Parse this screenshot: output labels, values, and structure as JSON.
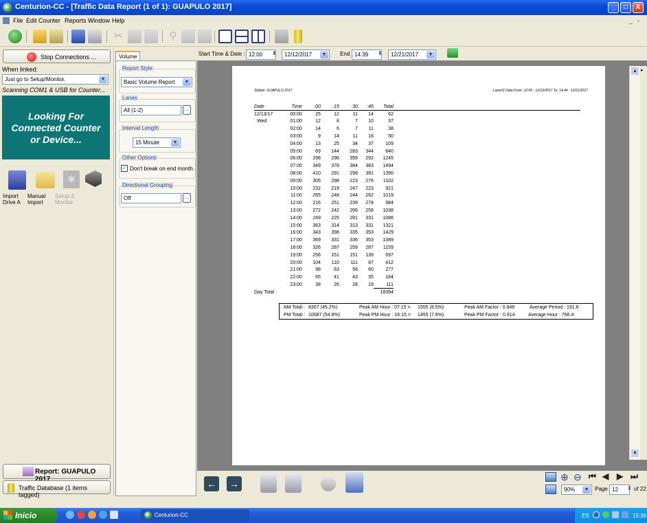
{
  "window": {
    "title": "Centurion-CC - [Traffic Data Report (1 of 1): GUAPULO 2017]",
    "controls": [
      "_",
      "□",
      "X"
    ]
  },
  "menu": {
    "items": [
      "File",
      "Edit",
      "Counter",
      "Reports",
      "Window",
      "Help"
    ]
  },
  "left": {
    "stop_button": "Stop Connections ...",
    "when_linked_label": "When linked:",
    "when_linked_value": "Just go to Setup/Monitor.",
    "scanning_text": "Scanning COM1 & USB for Counter...",
    "banner": [
      "Looking For",
      "Connected Counter",
      "or Device..."
    ],
    "icons": [
      {
        "label1": "Import",
        "label2": "Drive A"
      },
      {
        "label1": "Manual",
        "label2": "Import"
      },
      {
        "label1": "Setup &",
        "label2": "Monitor"
      }
    ],
    "report_button": "Report: GUAPULO 2017",
    "database_button": "Traffic Database (1 items tagged)"
  },
  "options": {
    "tab": "Volume",
    "report_style_label": "Report Style",
    "report_style_value": "Basic Volume Report",
    "lanes_label": "Lanes",
    "lanes_value": "All (1-2)",
    "interval_label": "Interval Length",
    "interval_value": "15 Minute",
    "other_label": "Other Options",
    "dont_break_label": "Don't break on end month.",
    "directional_label": "Directional Grouping",
    "directional_value": "Off"
  },
  "range": {
    "start_label": "Start Time & Date :",
    "start_time": "12:00",
    "start_date": "12/12/2017",
    "end_label": "End :",
    "end_time": "14:39",
    "end_date": "12/21/2017"
  },
  "report": {
    "station": "Station: GUAPULO 2017",
    "info": "Lane#2 Data From: 12:00 - 12/12/2017  To: 14:44 - 12/21/2017",
    "headers": [
      "Date",
      "Time",
      ":00",
      ":15",
      ":30",
      ":45",
      "Total"
    ],
    "date": "12/13/17",
    "day": "Wed",
    "rows": [
      [
        "00:00",
        "25",
        "12",
        "11",
        "14",
        "62"
      ],
      [
        "01:00",
        "12",
        "8",
        "7",
        "10",
        "37"
      ],
      [
        "02:00",
        "14",
        "6",
        "7",
        "11",
        "38"
      ],
      [
        "03:00",
        "9",
        "14",
        "11",
        "16",
        "50"
      ],
      [
        "04:00",
        "13",
        "25",
        "34",
        "37",
        "109"
      ],
      [
        "05:00",
        "69",
        "144",
        "283",
        "344",
        "840"
      ],
      [
        "06:00",
        "298",
        "296",
        "359",
        "292",
        "1245"
      ],
      [
        "07:00",
        "349",
        "378",
        "384",
        "383",
        "1494"
      ],
      [
        "08:00",
        "410",
        "291",
        "298",
        "391",
        "1390"
      ],
      [
        "09:00",
        "305",
        "298",
        "223",
        "276",
        "1102"
      ],
      [
        "10:00",
        "232",
        "219",
        "247",
        "223",
        "921"
      ],
      [
        "11:00",
        "265",
        "248",
        "244",
        "262",
        "1019"
      ],
      [
        "12:00",
        "216",
        "251",
        "239",
        "278",
        "984"
      ],
      [
        "13:00",
        "272",
        "242",
        "266",
        "258",
        "1038"
      ],
      [
        "14:00",
        "249",
        "225",
        "281",
        "331",
        "1086"
      ],
      [
        "15:00",
        "363",
        "314",
        "313",
        "331",
        "1321"
      ],
      [
        "16:00",
        "343",
        "398",
        "335",
        "353",
        "1429"
      ],
      [
        "17:00",
        "369",
        "331",
        "336",
        "353",
        "1389"
      ],
      [
        "18:00",
        "326",
        "287",
        "259",
        "287",
        "1159"
      ],
      [
        "19:00",
        "256",
        "151",
        "151",
        "139",
        "697"
      ],
      [
        "20:00",
        "104",
        "110",
        "111",
        "87",
        "412"
      ],
      [
        "21:00",
        "98",
        "63",
        "56",
        "60",
        "277"
      ],
      [
        "22:00",
        "65",
        "41",
        "43",
        "35",
        "184"
      ],
      [
        "23:00",
        "38",
        "26",
        "28",
        "19",
        "111"
      ]
    ],
    "day_total_label": "Day Total :",
    "day_total": "18394",
    "summary": {
      "am_total_label": "AM Total :",
      "am_total": "8307 (45.2%)",
      "pm_total_label": "PM Total :",
      "pm_total": "10087 (54.8%)",
      "peak_am_hour_label": "Peak AM Hour : 07:15 =",
      "peak_am_hour": "1555 (8.5%)",
      "peak_pm_hour_label": "Peak PM Hour : 16:15 =",
      "peak_pm_hour": "1455 (7.9%)",
      "peak_am_factor": "Peak AM Factor : 0.948",
      "peak_pm_factor": "Peak PM Factor : 0.914",
      "avg_period": "Average Period :  191.6",
      "avg_hour": "Average Hour :  766.4"
    }
  },
  "nav": {
    "zoom": "90%",
    "page_label": "Page",
    "page": "12",
    "of": "of 22."
  },
  "taskbar": {
    "start": "Inicio",
    "app": "Centurion-CC",
    "lang": "ES",
    "time": "15:36"
  },
  "colors": {
    "banner": "#0e7576",
    "titlebar": "#0a4bd6",
    "group_label": "#1d4cc3"
  }
}
